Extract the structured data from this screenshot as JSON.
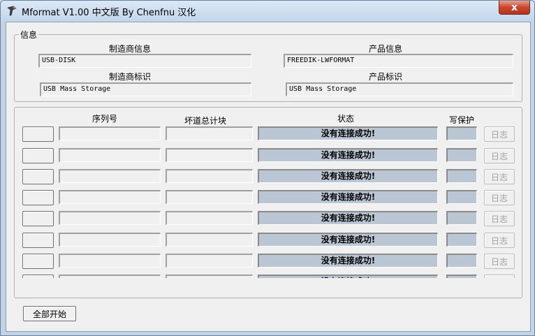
{
  "window": {
    "title": "Mformat V1.00 中文版 By Chenfnu 汉化",
    "close_label": "x"
  },
  "info_group": {
    "legend": "信息",
    "manufacturer_info_label": "制造商信息",
    "manufacturer_info_value": "USB-DISK",
    "product_info_label": "产品信息",
    "product_info_value": "FREEDIK-LWFORMAT",
    "manufacturer_id_label": "制造商标识",
    "manufacturer_id_value": "USB Mass Storage",
    "product_id_label": "产品标识",
    "product_id_value": "USB Mass Storage"
  },
  "table": {
    "headers": {
      "serial": "序列号",
      "bad_blocks": "坏道总计块",
      "status": "状态",
      "write_protect": "写保护"
    },
    "rows": [
      {
        "status": "没有连接成功!",
        "log_label": "日志"
      },
      {
        "status": "没有连接成功!",
        "log_label": "日志"
      },
      {
        "status": "没有连接成功!",
        "log_label": "日志"
      },
      {
        "status": "没有连接成功!",
        "log_label": "日志"
      },
      {
        "status": "没有连接成功!",
        "log_label": "日志"
      },
      {
        "status": "没有连接成功!",
        "log_label": "日志"
      },
      {
        "status": "没有连接成功!",
        "log_label": "日志"
      },
      {
        "status": "没有连接成功!",
        "log_label": "日志"
      }
    ]
  },
  "footer": {
    "start_all_label": "全部开始"
  },
  "colors": {
    "status_fill": "#bac6d4",
    "title_bar": "#c2d5ea",
    "close_button": "#c9462c"
  }
}
